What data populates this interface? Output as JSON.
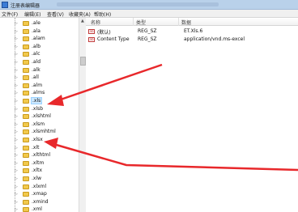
{
  "window": {
    "title": "注册表编辑器"
  },
  "menu": [
    "文件(F)",
    "编辑(E)",
    "查看(V)",
    "收藏夹(A)",
    "帮助(H)"
  ],
  "tree": {
    "items": [
      {
        "label": ".ale"
      },
      {
        "label": ".ala"
      },
      {
        "label": ".alam"
      },
      {
        "label": ".alb"
      },
      {
        "label": ".alc"
      },
      {
        "label": ".ald"
      },
      {
        "label": ".alk"
      },
      {
        "label": ".all"
      },
      {
        "label": ".alm"
      },
      {
        "label": ".alms"
      },
      {
        "label": ".xls",
        "selected": true
      },
      {
        "label": ".xlsb"
      },
      {
        "label": ".xlshtml"
      },
      {
        "label": ".xlsm"
      },
      {
        "label": ".xlsmhtml"
      },
      {
        "label": ".xlsx"
      },
      {
        "label": ".xlt"
      },
      {
        "label": ".xlthtml"
      },
      {
        "label": ".xltm"
      },
      {
        "label": ".xltx"
      },
      {
        "label": ".xlw"
      },
      {
        "label": ".xlxml"
      },
      {
        "label": ".xmap"
      },
      {
        "label": ".xmind"
      },
      {
        "label": ".xml"
      }
    ]
  },
  "list": {
    "headers": {
      "name": "名称",
      "type": "类型",
      "data": "数据"
    },
    "rows": [
      {
        "icon": "ab",
        "name": "(默认)",
        "type": "REG_SZ",
        "data": "ET.Xls.6"
      },
      {
        "icon": "ab",
        "name": "Content Type",
        "type": "REG_SZ",
        "data": "application/vnd.ms-excel"
      }
    ]
  },
  "colors": {
    "arrow": "#e8282b",
    "selection": "#cce8ff",
    "folder": "#f2c94c"
  }
}
